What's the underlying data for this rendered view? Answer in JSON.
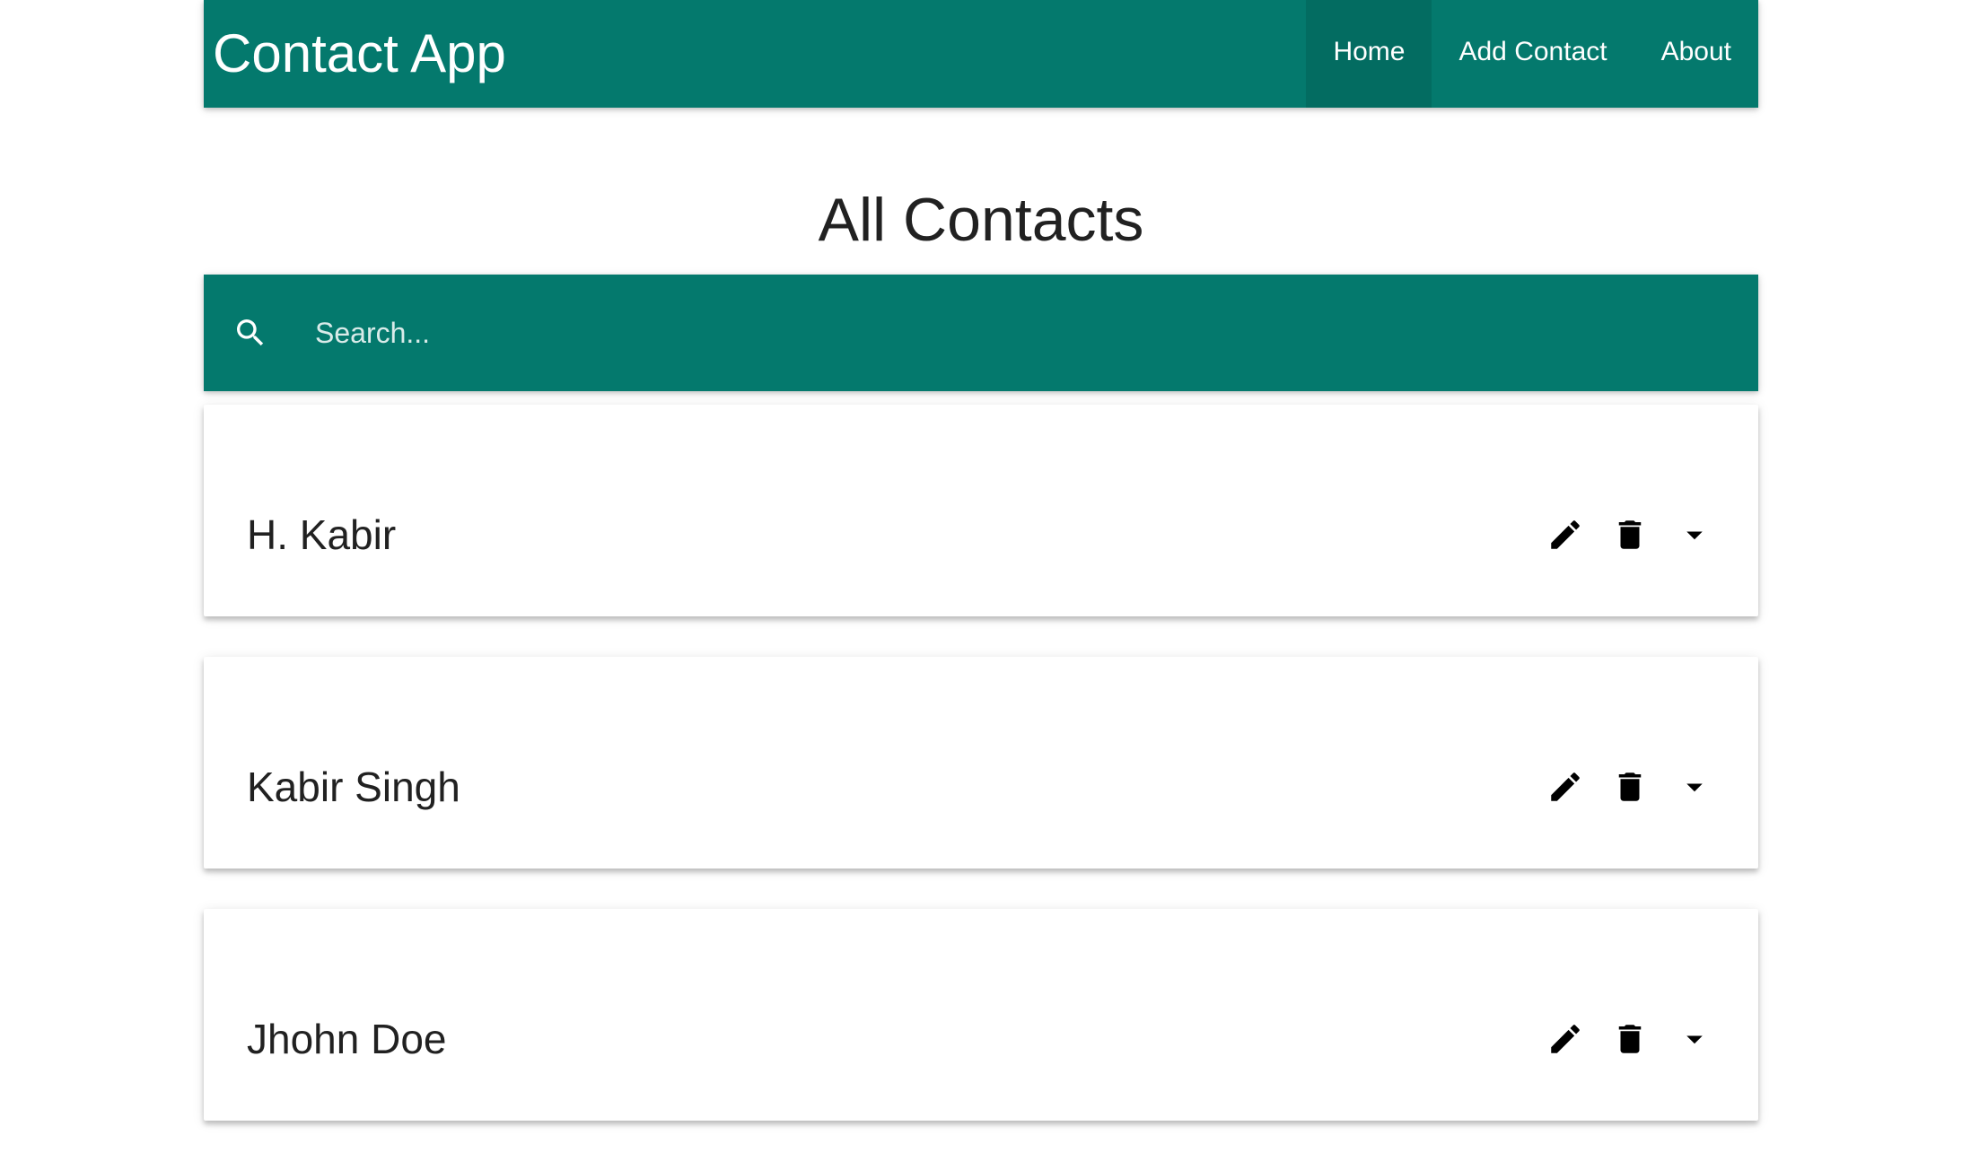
{
  "navbar": {
    "brand": "Contact App",
    "links": [
      {
        "label": "Home",
        "active": true
      },
      {
        "label": "Add Contact",
        "active": false
      },
      {
        "label": "About",
        "active": false
      }
    ]
  },
  "page": {
    "title": "All Contacts"
  },
  "search": {
    "placeholder": "Search...",
    "value": "",
    "icon": "search-icon"
  },
  "contacts": [
    {
      "name": "H. Kabir"
    },
    {
      "name": "Kabir Singh"
    },
    {
      "name": "Jhohn Doe"
    }
  ],
  "icons": {
    "edit": "pencil-icon",
    "delete": "trash-icon",
    "expand": "arrow-drop-down-icon"
  },
  "colors": {
    "primary": "#04796d",
    "text": "#212121",
    "on_primary": "#ffffff"
  }
}
